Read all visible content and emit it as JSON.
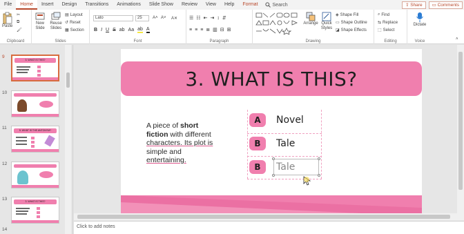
{
  "tabs": [
    "File",
    "Home",
    "Insert",
    "Design",
    "Transitions",
    "Animations",
    "Slide Show",
    "Review",
    "View",
    "Help",
    "Format"
  ],
  "active_tab": "Home",
  "search_label": "Search",
  "share_label": "Share",
  "comments_label": "Comments",
  "ribbon": {
    "clipboard": {
      "paste": "Paste",
      "group": "Clipboard"
    },
    "slides": {
      "new_slide": "New Slide",
      "reuse_slides": "Reuse Slides",
      "layout": "Layout",
      "reset": "Reset",
      "section": "Section",
      "group": "Slides"
    },
    "font": {
      "name": "Lato",
      "size": "25",
      "group": "Font",
      "case": "Aa"
    },
    "paragraph": {
      "group": "Paragraph"
    },
    "drawing": {
      "arrange": "Arrange",
      "quick_styles": "Quick Styles",
      "shape_fill": "Shape Fill",
      "shape_outline": "Shape Outline",
      "shape_effects": "Shape Effects",
      "group": "Drawing"
    },
    "editing": {
      "find": "Find",
      "replace": "Replace",
      "select": "Select",
      "group": "Editing"
    },
    "voice": {
      "dictate": "Dictate",
      "group": "Voice"
    }
  },
  "thumbnails": [
    {
      "num": "9",
      "title": "3. WHAT IS THIS?"
    },
    {
      "num": "10",
      "title": ""
    },
    {
      "num": "11",
      "title": "5. WHAT IS THE ANTONYM?"
    },
    {
      "num": "12",
      "title": ""
    },
    {
      "num": "13",
      "title": "3. WHAT IS THIS?"
    },
    {
      "num": "14",
      "title": ""
    }
  ],
  "slide": {
    "title": "3. WHAT IS THIS?",
    "body": {
      "p1": "A piece of ",
      "p1_bold": "short",
      "p2_bold": "fiction",
      "p2": " with different",
      "p3": "characters. Its plot is",
      "p4": "simple and",
      "p5": "entertaining."
    },
    "options": [
      {
        "letter": "A",
        "text": "Novel"
      },
      {
        "letter": "B",
        "text": "Tale"
      },
      {
        "letter": "B",
        "text": "Tale"
      }
    ]
  },
  "notes_placeholder": "Click to add notes",
  "colors": {
    "accent": "#f07fae",
    "brand": "#b7472a"
  }
}
